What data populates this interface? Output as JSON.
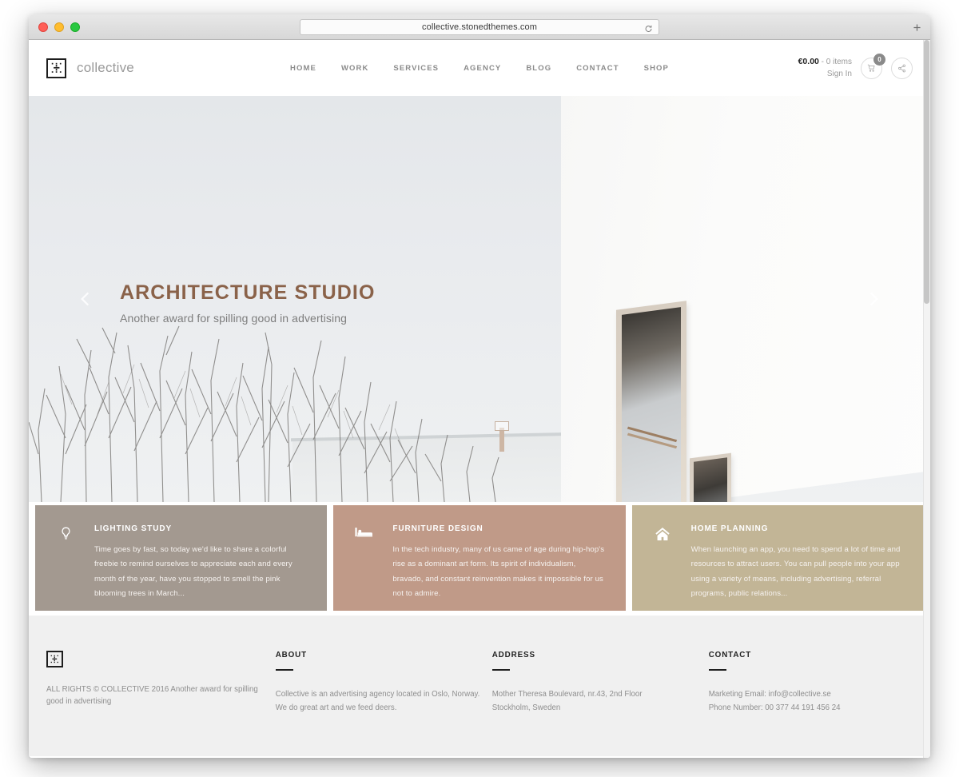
{
  "browser": {
    "url": "collective.stonedthemes.com",
    "reload_icon": "reload-icon",
    "new_tab_icon": "plus-icon",
    "traffic_lights": [
      "close",
      "minimize",
      "maximize"
    ]
  },
  "header": {
    "logo_icon": "collective-logo-icon",
    "brand": "collective",
    "nav": [
      {
        "label": "HOME"
      },
      {
        "label": "WORK"
      },
      {
        "label": "SERVICES"
      },
      {
        "label": "AGENCY"
      },
      {
        "label": "BLOG"
      },
      {
        "label": "CONTACT"
      },
      {
        "label": "SHOP"
      }
    ],
    "cart_price": "€0.00",
    "cart_separator": " - ",
    "cart_items": "0 items",
    "signin": "Sign In",
    "cart_badge": "0",
    "cart_icon": "shopping-cart-icon",
    "share_icon": "share-icon"
  },
  "hero": {
    "title": "ARCHITECTURE STUDIO",
    "subtitle": "Another award for spilling good in advertising",
    "prev_icon": "chevron-left-icon",
    "next_icon": "chevron-right-icon",
    "title_color": "#8a6249"
  },
  "features": [
    {
      "icon": "lightbulb-icon",
      "title": "LIGHTING STUDY",
      "text": "Time goes by fast, so today we'd like to share a colorful freebie to remind ourselves to appreciate each and every month of the year, have you stopped to smell the pink blooming trees in March...",
      "color": "#a39990"
    },
    {
      "icon": "bed-icon",
      "title": "FURNITURE DESIGN",
      "text": "In the tech industry, many of us came of age during hip-hop's rise as a dominant art form. Its spirit of individualism, bravado, and constant reinvention makes it impossible for us not to admire.",
      "color": "#c09a88"
    },
    {
      "icon": "home-icon",
      "title": "HOME PLANNING",
      "text": "When launching an app, you need to spend a lot of time and resources to attract users. You can pull people into your app using a variety of means, including advertising, referral programs, public relations...",
      "color": "#c2b596"
    }
  ],
  "footer": {
    "logo_icon": "collective-logo-icon",
    "copyright_line1": "ALL RIGHTS © COLLECTIVE 2016",
    "copyright_line2": "Another award for spilling good in advertising",
    "about": {
      "heading": "ABOUT",
      "text": "Collective is an advertising agency located in Oslo, Norway. We do great art and we feed deers."
    },
    "address": {
      "heading": "ADDRESS",
      "line1": "Mother Theresa Boulevard, nr.43, 2nd Floor",
      "line2": "Stockholm, Sweden"
    },
    "contact": {
      "heading": "CONTACT",
      "line1": "Marketing Email: info@collective.se",
      "line2": "Phone Number: 00 377 44 191 456 24"
    }
  }
}
